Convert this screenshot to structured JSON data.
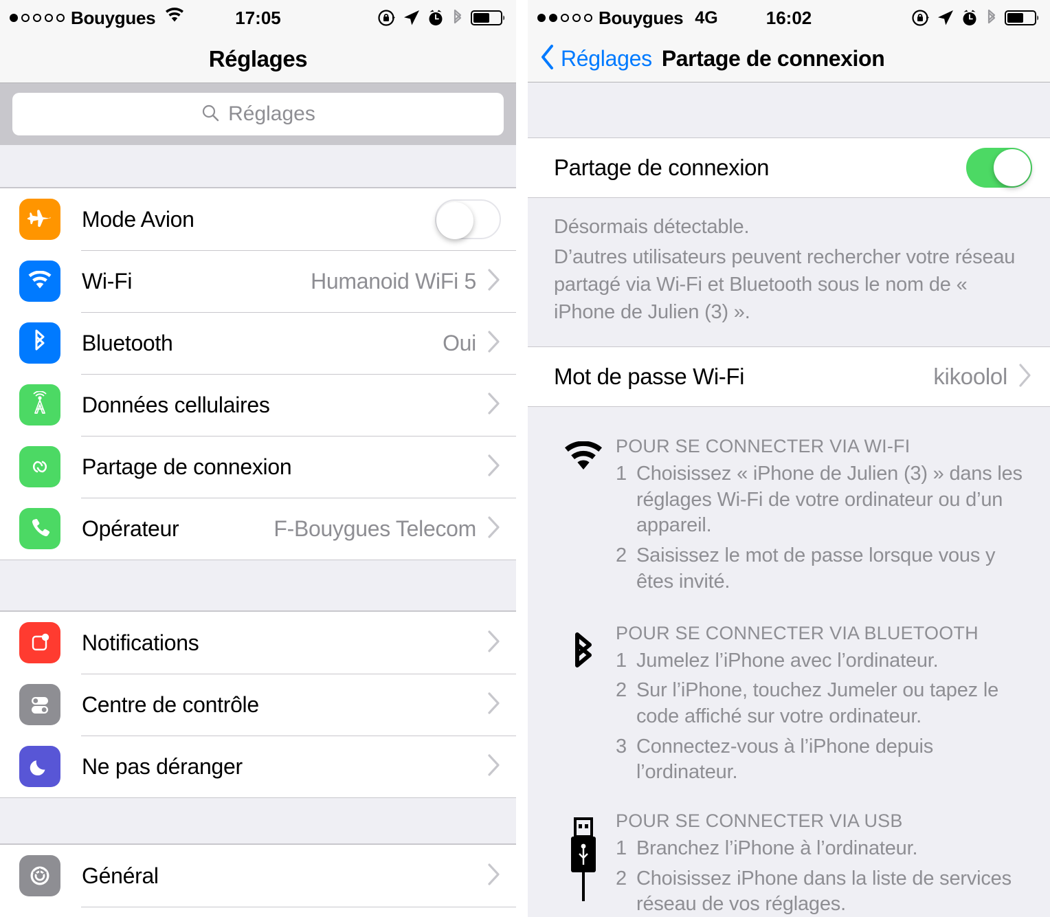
{
  "left": {
    "statusbar": {
      "signal_dots_filled": 1,
      "signal_dots_total": 5,
      "carrier": "Bouygues",
      "network": "",
      "wifi_icon": "wifi-icon",
      "time": "17:05",
      "icons": [
        "rotation-lock-icon",
        "location-arrow-icon",
        "alarm-clock-icon",
        "bluetooth-icon",
        "battery-icon"
      ]
    },
    "nav": {
      "title": "Réglages"
    },
    "search": {
      "placeholder": "Réglages",
      "icon": "search-icon"
    },
    "groups": [
      {
        "rows": [
          {
            "icon": "airplane-icon",
            "icon_color": "#ff9500",
            "label": "Mode Avion",
            "control": "toggle",
            "toggle_on": false
          },
          {
            "icon": "wifi-icon",
            "icon_color": "#007aff",
            "label": "Wi-Fi",
            "detail": "Humanoid WiFi 5",
            "control": "chevron"
          },
          {
            "icon": "bluetooth-icon",
            "icon_color": "#007aff",
            "label": "Bluetooth",
            "detail": "Oui",
            "control": "chevron"
          },
          {
            "icon": "cellular-antenna-icon",
            "icon_color": "#4cd964",
            "label": "Données cellulaires",
            "detail": "",
            "control": "chevron"
          },
          {
            "icon": "personal-hotspot-icon",
            "icon_color": "#4cd964",
            "label": "Partage de connexion",
            "detail": "",
            "control": "chevron"
          },
          {
            "icon": "phone-icon",
            "icon_color": "#4cd964",
            "label": "Opérateur",
            "detail": "F-Bouygues Telecom",
            "control": "chevron"
          }
        ]
      },
      {
        "rows": [
          {
            "icon": "notifications-icon",
            "icon_color": "#ff3b30",
            "label": "Notifications",
            "detail": "",
            "control": "chevron"
          },
          {
            "icon": "control-center-icon",
            "icon_color": "#8e8e93",
            "label": "Centre de contrôle",
            "detail": "",
            "control": "chevron"
          },
          {
            "icon": "do-not-disturb-moon-icon",
            "icon_color": "#5856d6",
            "label": "Ne pas déranger",
            "detail": "",
            "control": "chevron"
          }
        ]
      },
      {
        "rows": [
          {
            "icon": "gear-icon",
            "icon_color": "#8e8e93",
            "label": "Général",
            "detail": "",
            "control": "chevron"
          }
        ]
      }
    ]
  },
  "right": {
    "statusbar": {
      "signal_dots_filled": 2,
      "signal_dots_total": 5,
      "carrier": "Bouygues",
      "network": "4G",
      "time": "16:02",
      "icons": [
        "rotation-lock-icon",
        "location-arrow-icon",
        "alarm-clock-icon",
        "bluetooth-icon",
        "battery-icon"
      ]
    },
    "nav": {
      "back_label": "Réglages",
      "back_icon": "chevron-left-icon",
      "title": "Partage de connexion"
    },
    "hotspot_row": {
      "label": "Partage de connexion",
      "toggle_on": true
    },
    "footer_lines": [
      "Désormais détectable.",
      "D’autres utilisateurs peuvent rechercher votre réseau partagé via Wi-Fi et Bluetooth sous le nom de « iPhone de Julien (3) »."
    ],
    "password_row": {
      "label": "Mot de passe Wi-Fi",
      "value": "kikoolol"
    },
    "instructions": [
      {
        "icon": "wifi-icon",
        "title": "POUR SE CONNECTER VIA WI-FI",
        "steps": [
          {
            "num": "1",
            "text": "Choisissez « iPhone de Julien (3) » dans les réglages Wi-Fi de votre ordinateur ou d’un appareil."
          },
          {
            "num": "2",
            "text": "Saisissez le mot de passe lorsque vous y êtes invité."
          }
        ]
      },
      {
        "icon": "bluetooth-icon",
        "title": "POUR SE CONNECTER VIA BLUETOOTH",
        "steps": [
          {
            "num": "1",
            "text": "Jumelez l’iPhone avec l’ordinateur."
          },
          {
            "num": "2",
            "text": "Sur l’iPhone, touchez Jumeler ou tapez le code affiché sur votre ordinateur."
          },
          {
            "num": "3",
            "text": "Connectez-vous à l’iPhone depuis l’ordinateur."
          }
        ]
      },
      {
        "icon": "usb-icon",
        "title": "POUR SE CONNECTER VIA USB",
        "steps": [
          {
            "num": "1",
            "text": "Branchez l’iPhone à l’ordinateur."
          },
          {
            "num": "2",
            "text": "Choisissez iPhone dans la liste de services réseau de vos réglages."
          }
        ]
      }
    ]
  },
  "colors": {
    "accent_blue": "#007aff",
    "toggle_green": "#4cd964",
    "group_bg": "#efeff4",
    "separator": "#c8c7cc",
    "secondary_text": "#8e8e93"
  }
}
